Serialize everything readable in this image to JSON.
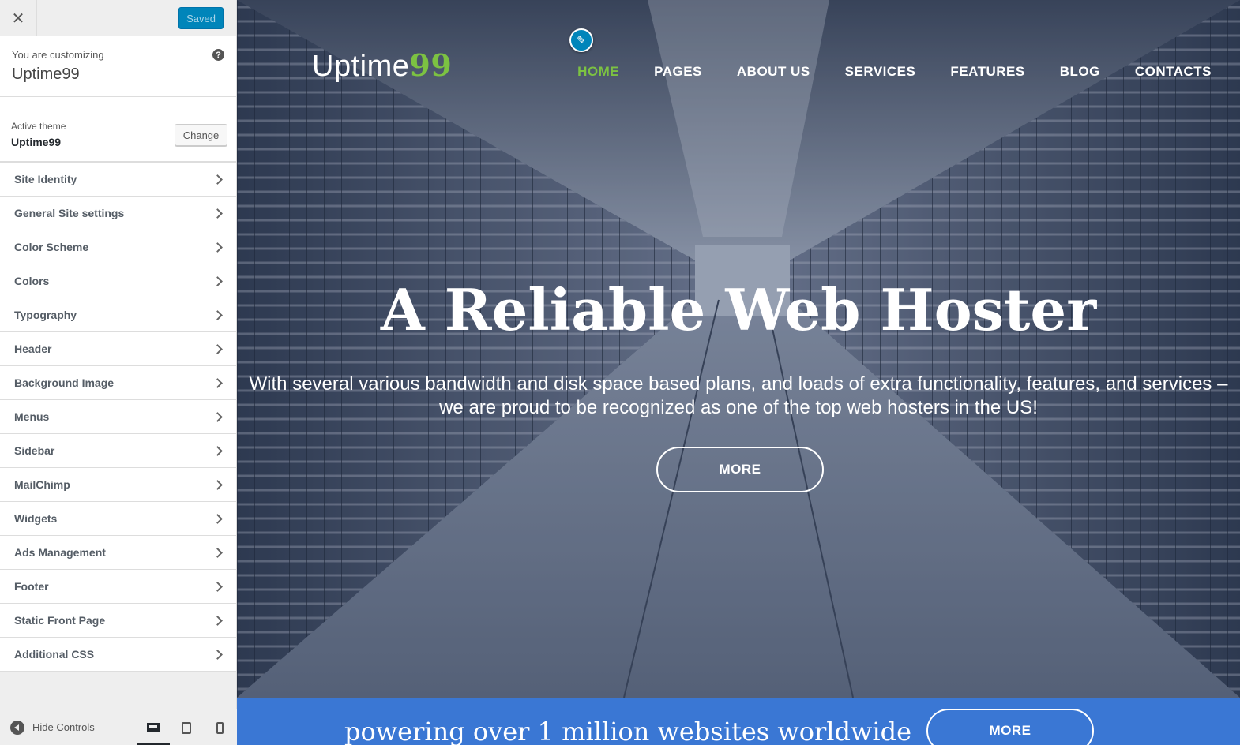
{
  "customizer": {
    "close_icon": "close-icon",
    "save_label": "Saved",
    "customizing_label": "You are customizing",
    "site_name": "Uptime99",
    "help_icon_glyph": "?",
    "active_theme_label": "Active theme",
    "active_theme_name": "Uptime99",
    "change_label": "Change",
    "sections": [
      {
        "label": "Site Identity"
      },
      {
        "label": "General Site settings"
      },
      {
        "label": "Color Scheme"
      },
      {
        "label": "Colors"
      },
      {
        "label": "Typography"
      },
      {
        "label": "Header"
      },
      {
        "label": "Background Image"
      },
      {
        "label": "Menus"
      },
      {
        "label": "Sidebar"
      },
      {
        "label": "MailChimp"
      },
      {
        "label": "Widgets"
      },
      {
        "label": "Ads Management"
      },
      {
        "label": "Footer"
      },
      {
        "label": "Static Front Page"
      },
      {
        "label": "Additional CSS"
      }
    ],
    "hide_controls_label": "Hide Controls",
    "devices": [
      "desktop",
      "tablet",
      "mobile"
    ],
    "active_device": "desktop"
  },
  "preview": {
    "logo_text": "Uptime",
    "logo_number": "99",
    "nav": [
      {
        "label": "HOME",
        "active": true
      },
      {
        "label": "PAGES"
      },
      {
        "label": "ABOUT US"
      },
      {
        "label": "SERVICES"
      },
      {
        "label": "FEATURES"
      },
      {
        "label": "BLOG"
      },
      {
        "label": "CONTACTS"
      }
    ],
    "hero_title": "A Reliable Web Hoster",
    "hero_subtitle": "With several various bandwidth and disk space based plans, and loads of extra functionality, features, and services – we are proud to be recognized as one of the top web hosters in the US!",
    "hero_button": "MORE",
    "band_text": "powering over 1 million websites worldwide",
    "band_button": "MORE"
  },
  "colors": {
    "accent_green": "#7cc242",
    "wp_blue": "#0085ba",
    "band_blue": "#3a77d4"
  }
}
